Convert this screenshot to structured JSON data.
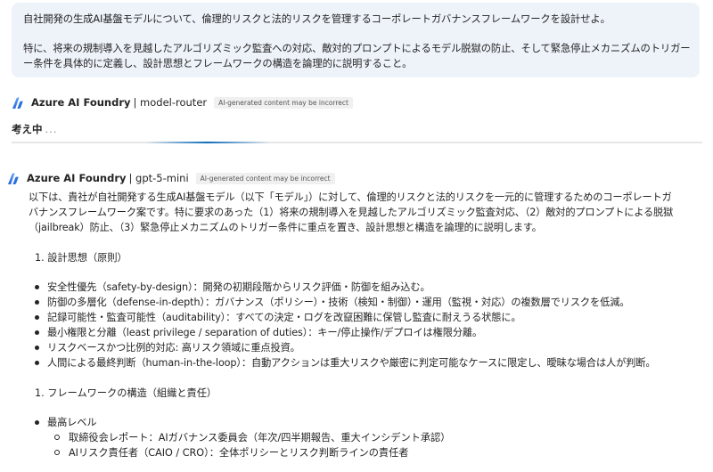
{
  "user_message": {
    "line1": "自社開発の生成AI基盤モデルについて、倫理的リスクと法的リスクを管理するコーポレートガバナンスフレームワークを設計せよ。",
    "line2": "特に、将来の規制導入を見越したアルゴリズミック監査への対応、敵対的プロンプトによるモデル脱獄の防止、そして緊急停止メカニズムのトリガー",
    "line3": "ー条件を具体的に定義し、設計思想とフレームワークの構造を論理的に説明すること。"
  },
  "router_header": {
    "name": "Azure AI Foundry",
    "model": "| model-router",
    "badge": "AI-generated content may be incorrect",
    "logo_icon": "azure-ai-foundry-logo-icon"
  },
  "thinking": {
    "label": "考え中",
    "dots": "..."
  },
  "response_header": {
    "name": "Azure AI Foundry",
    "model": "| gpt-5-mini",
    "badge": "AI-generated content may be incorrect",
    "logo_icon": "azure-ai-foundry-logo-icon"
  },
  "response": {
    "intro_lines": [
      "以下は、貴社が自社開発する生成AI基盤モデル（以下「モデル」）に対して、倫理的リスクと法的リスクを一元的に管理するためのコーポレートガ",
      "バナンスフレームワーク案です。特に要求のあった（1）将来の規制導入を見越したアルゴリズミック監査対応、（2）敵対的プロンプトによる脱獄",
      "（jailbreak）防止、（3）緊急停止メカニズムのトリガー条件に重点を置き、設計思想と構造を論理的に説明します。"
    ],
    "section1_title": "1. 設計思想（原則）",
    "section1_items": [
      "安全性優先（safety-by-design）：開発の初期段階からリスク評価・防御を組み込む。",
      "防御の多層化（defense-in-depth）：ガバナンス（ポリシー）・技術（検知・制御）・運用（監視・対応）の複数層でリスクを低減。",
      "記録可能性・監査可能性（auditability）：すべての決定・ログを改竄困難に保管し監査に耐えうる状態に。",
      "最小権限と分離（least privilege / separation of duties）：キー/停止操作/デプロイは権限分離。",
      "リスクベースかつ比例的対応: 高リスク領域に重点投資。",
      "人間による最終判断（human-in-the-loop）：自動アクションは重大リスクや厳密に判定可能なケースに限定し、曖昧な場合は人が判断。"
    ],
    "section2_title": "1. フレームワークの構造（組織と責任）",
    "section2_items": [
      "最高レベル"
    ],
    "section2_subitems": [
      "取締役会レポート：AIガバナンス委員会（年次/四半期報告、重大インシデント承認）",
      "AIリスク責任者（CAIO / CRO）：全体ポリシーとリスク判断ラインの責任者"
    ]
  },
  "colors": {
    "bubble_bg": "#eef3fa",
    "accent": "#0f6cbd",
    "badge_bg": "#f0f0f0"
  }
}
